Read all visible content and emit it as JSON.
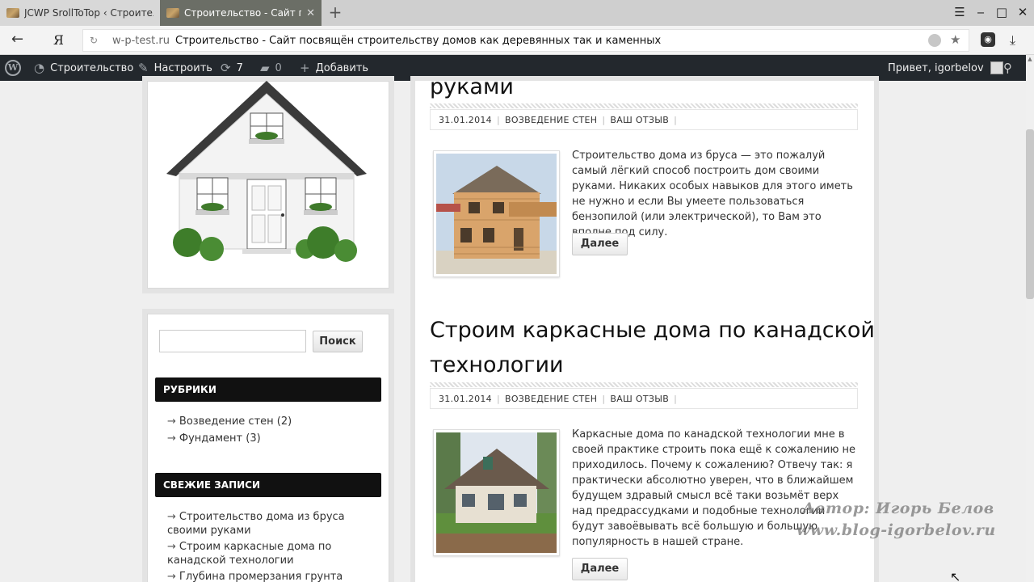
{
  "browser": {
    "tabs": [
      {
        "title": "JCWP SrollToTop ‹ Строительство"
      },
      {
        "title": "Строительство - Сайт посвящён строительству домов"
      }
    ],
    "new_tab": "+",
    "tab_close": "✕",
    "url_domain": "w-p-test.ru",
    "url_title": "Строительство - Сайт посвящён строительству домов как деревянных так и каменных",
    "yandex_label": "Я"
  },
  "adminbar": {
    "site_name": "Строительство",
    "customize": "Настроить",
    "updates_count": "7",
    "comments_count": "0",
    "add_new": "Добавить",
    "greeting": "Привет, igorbelov"
  },
  "sidebar": {
    "search_button": "Поиск",
    "search_placeholder": "",
    "categories_title": "РУБРИКИ",
    "categories": [
      {
        "label": "Возведение стен (2)"
      },
      {
        "label": "Фундамент (3)"
      }
    ],
    "recent_title": "СВЕЖИЕ ЗАПИСИ",
    "recent": [
      {
        "line1": "Строительство дома из бруса",
        "line2": "своими руками"
      },
      {
        "line1": "Строим каркасные дома по",
        "line2": "канадской технологии"
      },
      {
        "line1": "Глубина промерзания грунта",
        "line2": ""
      }
    ]
  },
  "posts": [
    {
      "title_tail": "руками",
      "date": "31.01.2014",
      "category": "ВОЗВЕДЕНИЕ СТЕН",
      "comments": "ВАШ ОТЗЫВ",
      "excerpt": "Строительство дома из бруса — это пожалуй самый лёгкий способ построить дом своими руками. Никаких особых навыков для этого иметь не нужно и если Вы умеете пользоваться бензопилой (или электрической), то Вам это вполне под силу.",
      "more": "Далее"
    },
    {
      "title_line1": "Строим каркасные дома по канадской",
      "title_line2": "технологии",
      "date": "31.01.2014",
      "category": "ВОЗВЕДЕНИЕ СТЕН",
      "comments": "ВАШ ОТЗЫВ",
      "excerpt": "Каркасные дома по канадской технологии мне в своей практике строить пока ещё к сожалению не приходилось. Почему к сожалению? Отвечу так: я практически абсолютно уверен, что в ближайшем будущем здравый смысл всё таки возьмёт верх над предрассудками и подобные технологии будут завоёвывать всё большую и большую популярность в нашей стране.",
      "more": "Далее"
    }
  ],
  "watermark": {
    "line1": "Автор: Игорь Белов",
    "line2": "www.blog-igorbelov.ru"
  },
  "colors": {
    "adminbar": "#23282d",
    "active_tab": "#6b6e66",
    "widget_title_bg": "#111111"
  }
}
